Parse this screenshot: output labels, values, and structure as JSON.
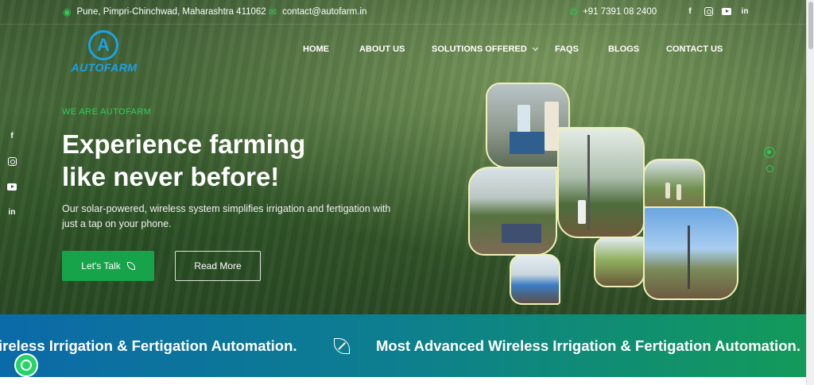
{
  "topbar": {
    "address": "Pune, Pimpri-Chinchwad, Maharashtra 411062",
    "email": "contact@autofarm.in",
    "phone": "+91 7391 08 2400",
    "social": [
      "facebook-icon",
      "instagram-icon",
      "youtube-icon",
      "linkedin-icon"
    ]
  },
  "logo": {
    "text": "AUTOFARM",
    "mark": "A"
  },
  "nav": {
    "items": [
      "HOME",
      "ABOUT US",
      "SOLUTIONS OFFERED",
      "FAQS",
      "BLOGS",
      "CONTACT US"
    ]
  },
  "hero": {
    "eyebrow": "WE ARE AUTOFARM",
    "headline_line1": "Experience farming",
    "headline_line2": "like never before!",
    "subtitle": "Our solar-powered, wireless system simplifies irrigation and fertigation with just a tap on your phone.",
    "cta_primary": "Let's Talk",
    "cta_secondary": "Read More"
  },
  "marquee": {
    "text1": "ireless Irrigation & Fertigation Automation.",
    "text2": "Most Advanced Wireless Irrigation & Fertigation Automation."
  },
  "colors": {
    "accent_green": "#2ecc59",
    "brand_blue": "#1da1e6",
    "button_green": "#16a34a"
  }
}
